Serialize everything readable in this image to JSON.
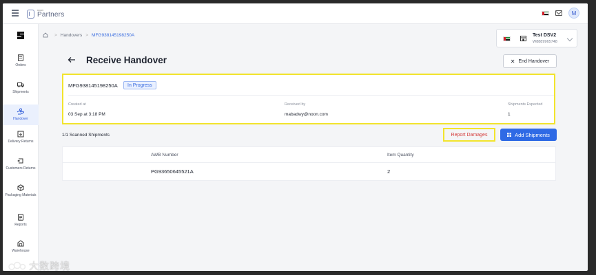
{
  "topbar": {
    "brand_small": "noon",
    "brand_name": "Partners",
    "user_initial": "M"
  },
  "sidebar": {
    "items": [
      {
        "label": "Orders",
        "icon": "orders-icon"
      },
      {
        "label": "Shipments",
        "icon": "truck-icon"
      },
      {
        "label": "Handover",
        "icon": "handover-icon",
        "active": true
      },
      {
        "label": "Delivery Returns",
        "icon": "delivery-returns-icon"
      },
      {
        "label": "Customers Returns",
        "icon": "customer-returns-icon"
      },
      {
        "label": "Packaging Materials",
        "icon": "package-icon"
      },
      {
        "label": "Reports",
        "icon": "reports-icon"
      },
      {
        "label": "Warehouse",
        "icon": "warehouse-icon"
      }
    ]
  },
  "breadcrumb": {
    "parent": "Handovers",
    "current": "MFG938145198250A"
  },
  "warehouse": {
    "name": "Test DSV2",
    "id": "W8889965748"
  },
  "page": {
    "title": "Receive Handover",
    "end_button": "End Handover"
  },
  "handover": {
    "id": "MFG938145198250A",
    "status": "In Progress",
    "created_label": "Created at",
    "created_value": "03 Sep at 3:18 PM",
    "received_label": "Received by",
    "received_value": "mabadwy@noon.com",
    "expected_label": "Shipments Expected",
    "expected_value": "1"
  },
  "scan": {
    "summary": "1/1 Scanned Shipments",
    "report_button": "Report Damages",
    "add_button": "Add Shipments"
  },
  "table": {
    "headers": [
      "AWB Number",
      "Item Quantity"
    ],
    "rows": [
      [
        "PG93650645521A",
        "2"
      ]
    ]
  },
  "watermark": {
    "text": "大数跨境"
  },
  "colors": {
    "accent": "#2f6ae5",
    "highlight": "#f2e42c",
    "danger": "#d43a3a"
  }
}
